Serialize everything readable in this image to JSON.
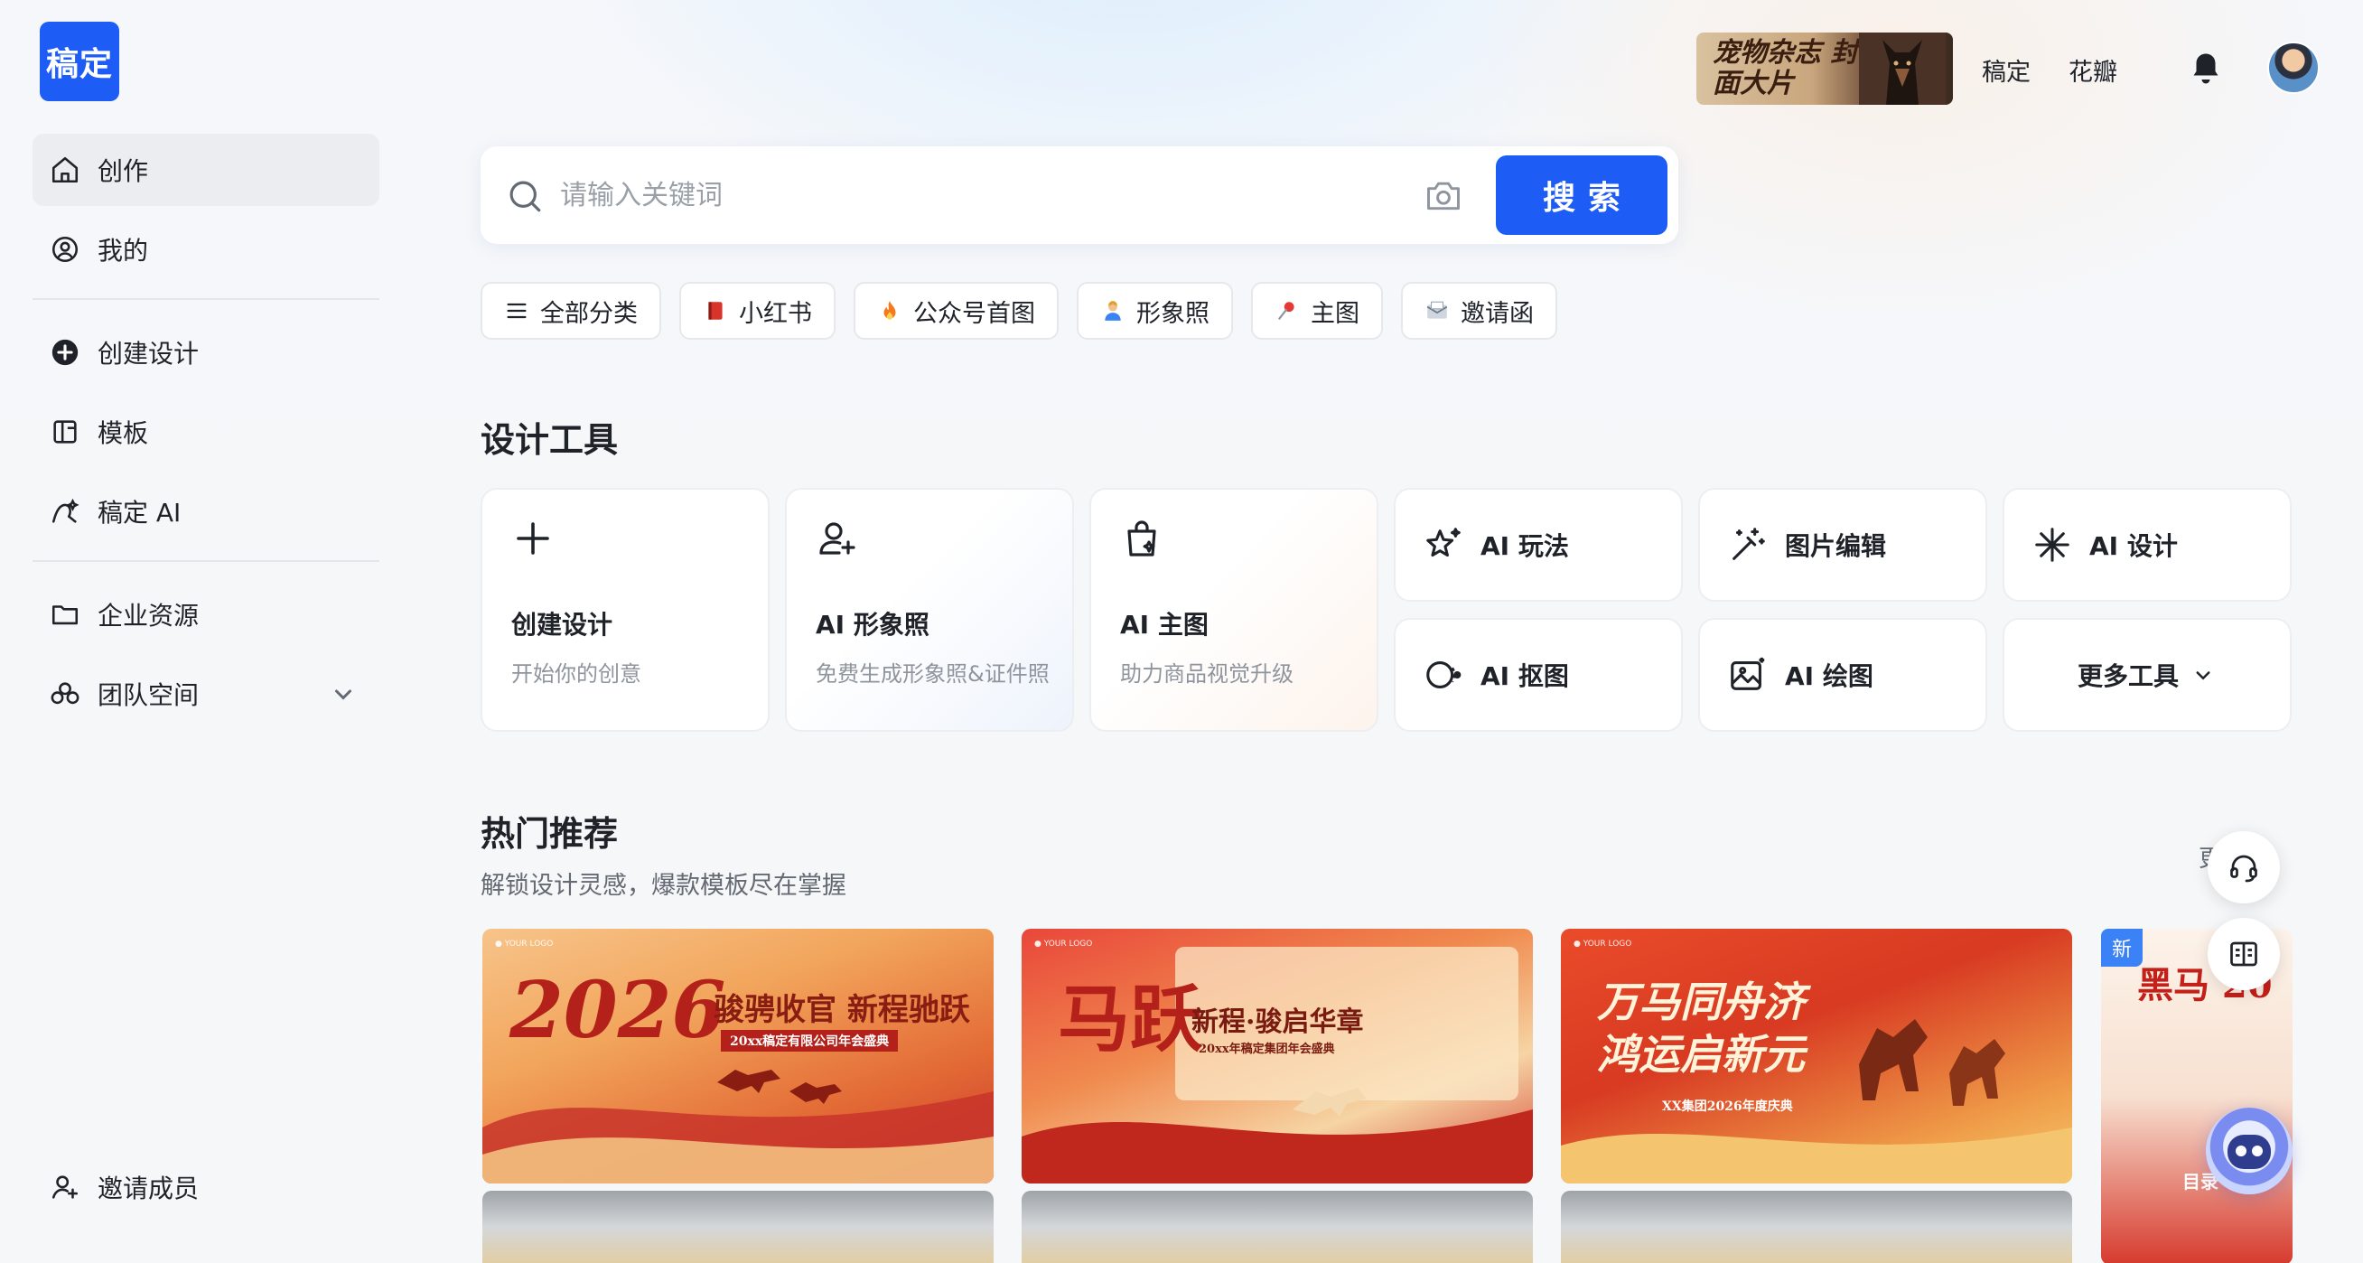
{
  "app": {
    "logo": "稿定"
  },
  "sidebar": {
    "items": [
      {
        "label": "创作",
        "icon": "home-icon"
      },
      {
        "label": "我的",
        "icon": "user-circle-icon"
      },
      {
        "label": "创建设计",
        "icon": "plus-circle-icon"
      },
      {
        "label": "模板",
        "icon": "template-icon"
      },
      {
        "label": "稿定 AI",
        "icon": "ai-pen-icon"
      },
      {
        "label": "企业资源",
        "icon": "folder-icon"
      },
      {
        "label": "团队空间",
        "icon": "team-icon"
      }
    ],
    "invite": {
      "label": "邀请成员",
      "icon": "add-user-icon"
    }
  },
  "topbar": {
    "promo_text": "宠物杂志 封面大片",
    "links": [
      "稿定",
      "花瓣"
    ],
    "bell_icon": "bell-icon"
  },
  "search": {
    "placeholder": "请输入关键词",
    "button": "搜索"
  },
  "categories": [
    {
      "label": "全部分类",
      "icon": "menu-icon"
    },
    {
      "label": "小红书",
      "icon": "book-icon"
    },
    {
      "label": "公众号首图",
      "icon": "fire-icon"
    },
    {
      "label": "形象照",
      "icon": "person-icon"
    },
    {
      "label": "主图",
      "icon": "pin-icon"
    },
    {
      "label": "邀请函",
      "icon": "envelope-icon"
    }
  ],
  "tools": {
    "title": "设计工具",
    "big": [
      {
        "name": "创建设计",
        "desc": "开始你的创意"
      },
      {
        "name": "AI 形象照",
        "desc": "免费生成形象照&证件照"
      },
      {
        "name": "AI 主图",
        "desc": "助力商品视觉升级"
      }
    ],
    "small": [
      {
        "name": "AI 玩法"
      },
      {
        "name": "图片编辑"
      },
      {
        "name": "AI 设计"
      },
      {
        "name": "AI 抠图"
      },
      {
        "name": "AI 绘图"
      },
      {
        "name": "更多工具"
      }
    ]
  },
  "hot": {
    "title": "热门推荐",
    "subtitle": "解锁设计灵感，爆款模板尽在掌握",
    "more": "更多",
    "templates": [
      {
        "big": "2026",
        "headline": "骏骋收官 新程驰跃",
        "sub": "20xx稿定有限公司年会盛典"
      },
      {
        "big": "马跃",
        "headline": "新程·骏启华章",
        "sub": "20xx年稿定集团年会盛典"
      },
      {
        "big": "万马同舟济 鸿运启新元",
        "headline": "",
        "sub": "XX集团2026年度庆典"
      },
      {
        "big": "黑马 20",
        "headline": "",
        "sub": "目录",
        "badge": "新"
      }
    ]
  }
}
